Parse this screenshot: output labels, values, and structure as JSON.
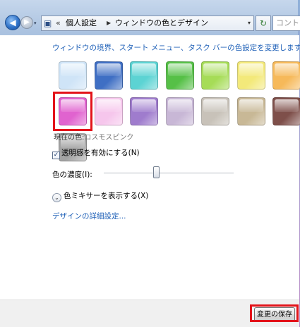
{
  "nav": {
    "back_glyph": "◀",
    "forward_glyph": "▶",
    "history_dropdown_glyph": "▾",
    "breadcrumb_prefix": "«",
    "breadcrumbs": [
      "個人設定",
      "ウィンドウの色とデザイン"
    ],
    "address_dropdown_glyph": "▾",
    "refresh_glyph": "↻",
    "search_placeholder": "コントロ"
  },
  "main": {
    "headline": "ウィンドウの境界、スタート メニュー、タスク バーの色設定を変更します",
    "swatches": [
      {
        "name": "sky",
        "color": "#cfe4f7"
      },
      {
        "name": "twilight",
        "color": "#3f6fc4"
      },
      {
        "name": "sea",
        "color": "#5cd3d3"
      },
      {
        "name": "leaf",
        "color": "#56c047"
      },
      {
        "name": "lime",
        "color": "#a6dc57"
      },
      {
        "name": "lemon",
        "color": "#f3e97a"
      },
      {
        "name": "pumpkin",
        "color": "#f6b95a"
      },
      {
        "name": "cosmos-pink",
        "color": "#e063cf"
      },
      {
        "name": "blush",
        "color": "#f6c6ec"
      },
      {
        "name": "lavender",
        "color": "#9f7ccd"
      },
      {
        "name": "violet-grey",
        "color": "#c8b7d6"
      },
      {
        "name": "taupe",
        "color": "#c8c2b9"
      },
      {
        "name": "khaki",
        "color": "#c8b896"
      },
      {
        "name": "chocolate",
        "color": "#7e4f4a"
      },
      {
        "name": "slate",
        "color": "#a3a3a3"
      }
    ],
    "selected_index": 7,
    "current_color_label": "現在の色:",
    "current_color_value": "コスモスピンク",
    "transparency_label": "透明感を有効にする(N)",
    "transparency_checked": true,
    "transparency_check_glyph": "✓",
    "intensity_label": "色の濃度(I):",
    "intensity_value": 0.4,
    "mixer_label": "色ミキサーを表示する(X)",
    "mixer_glyph": "⌄",
    "advanced_link": "デザインの詳細設定..."
  },
  "footer": {
    "save_label": "変更の保存"
  },
  "colors": {
    "link": "#1d5fb7",
    "highlight": "#e3131a"
  }
}
